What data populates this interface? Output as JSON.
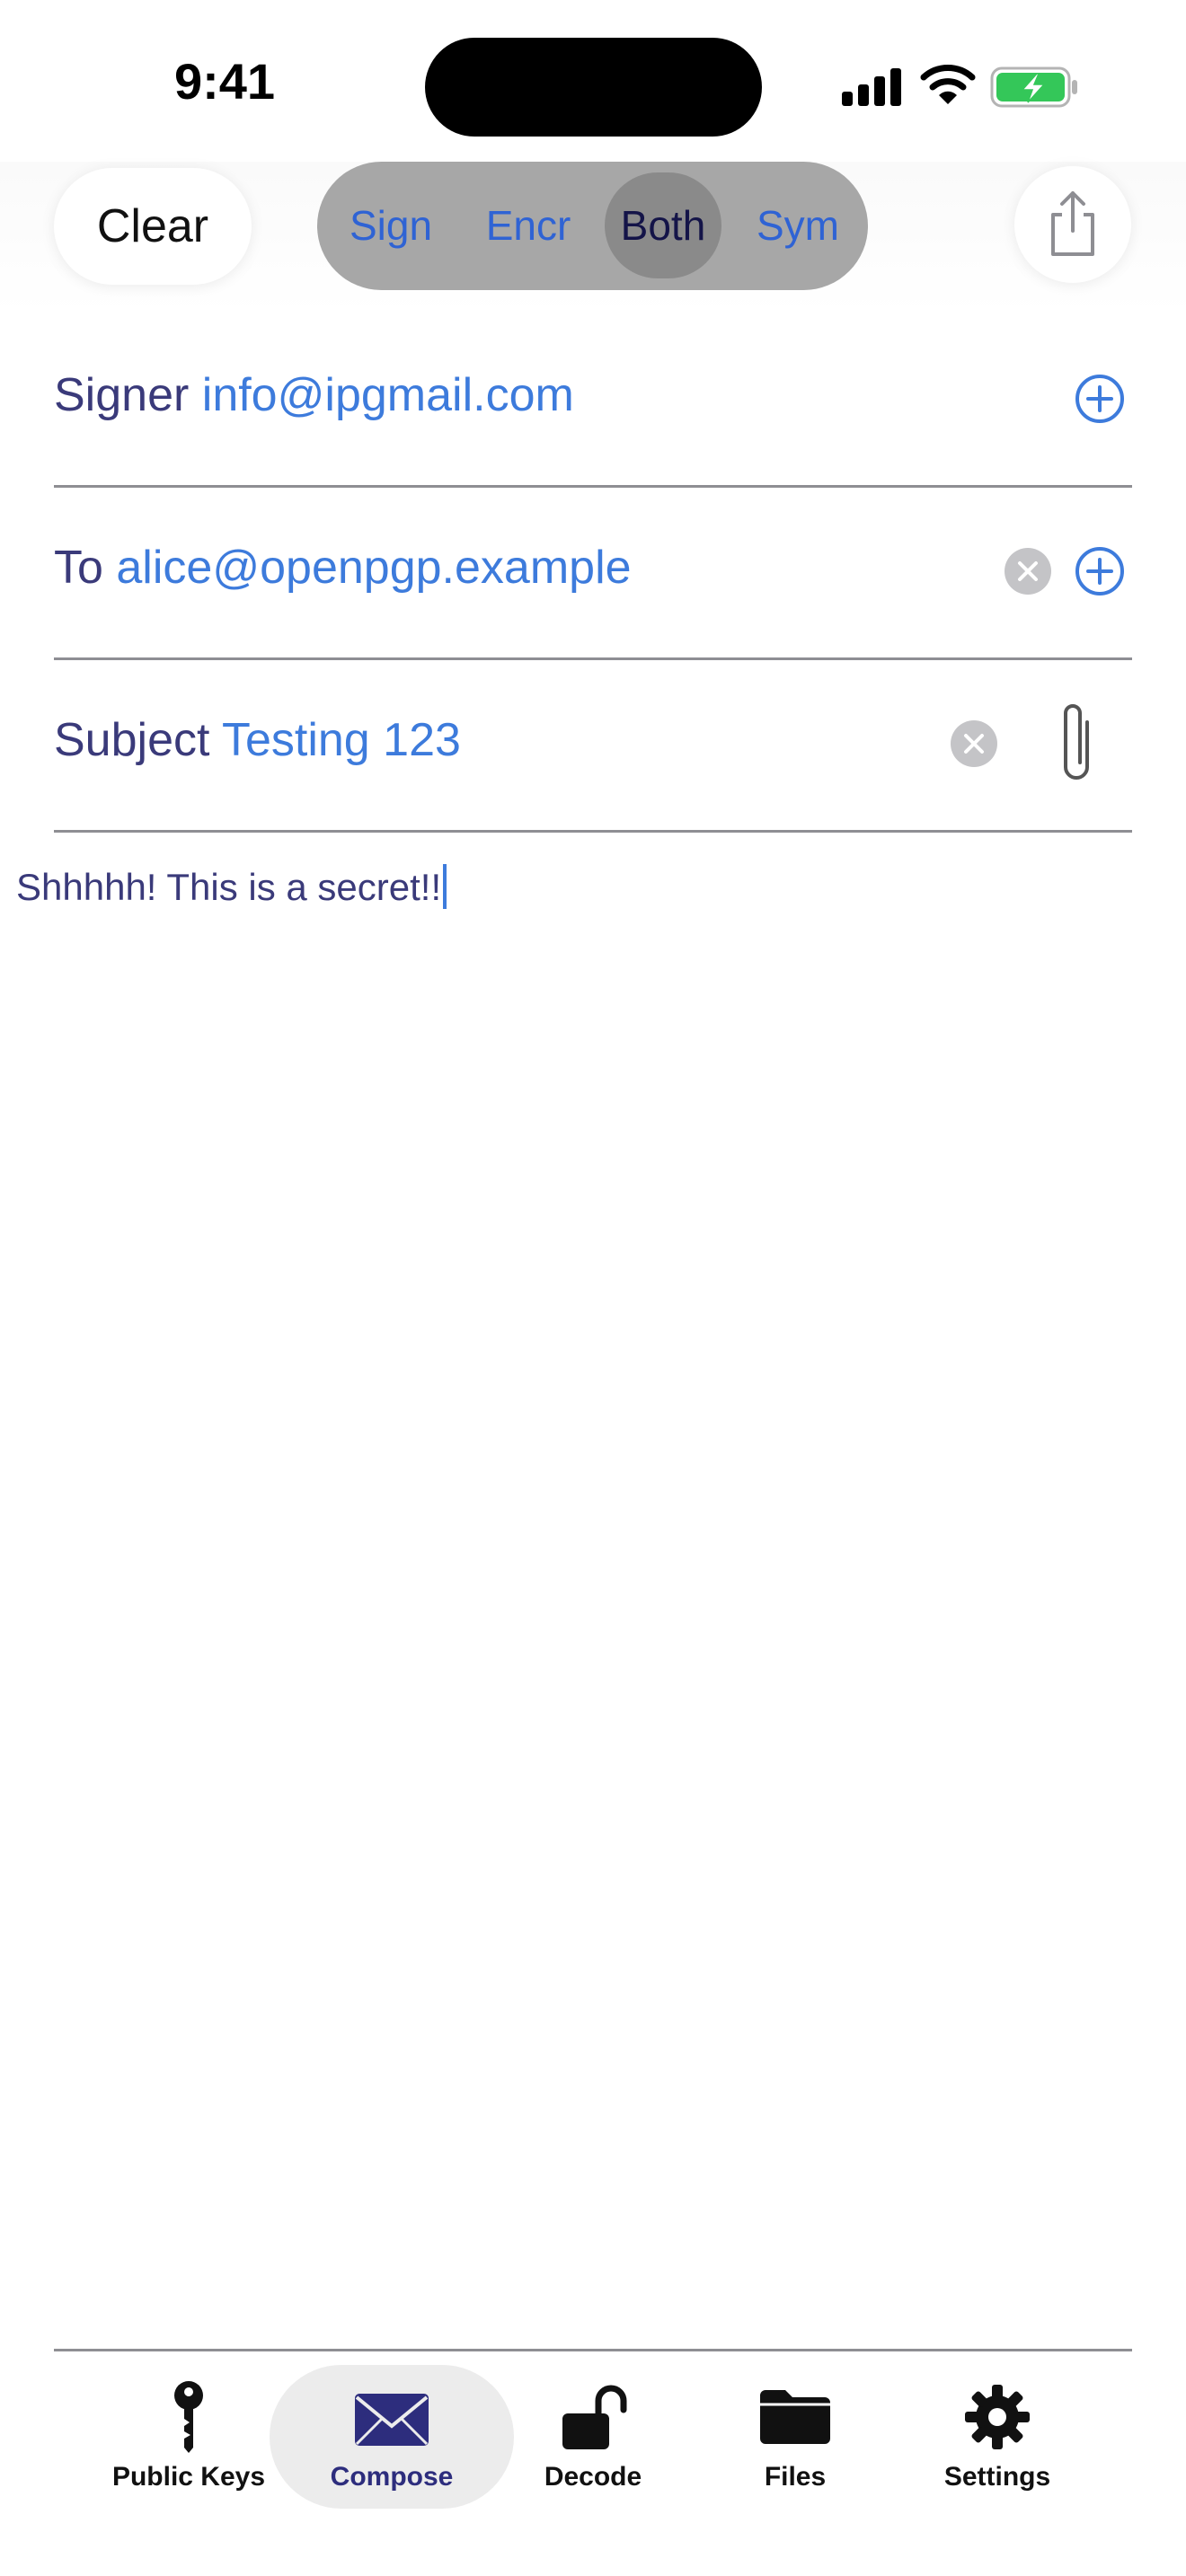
{
  "status_bar": {
    "time": "9:41"
  },
  "toolbar": {
    "clear_label": "Clear",
    "modes": [
      "Sign",
      "Encr",
      "Both",
      "Sym"
    ],
    "selected_mode": "Both"
  },
  "form": {
    "signer": {
      "label": "Signer",
      "value": "info@ipgmail.com"
    },
    "to": {
      "label": "To",
      "value": "alice@openpgp.example"
    },
    "subject": {
      "label": "Subject",
      "value": "Testing 123"
    }
  },
  "message": {
    "text": "Shhhhh! This is a secret!!"
  },
  "tabbar": {
    "items": [
      {
        "label": "Public Keys",
        "icon": "key-icon"
      },
      {
        "label": "Compose",
        "icon": "envelope-icon",
        "selected": true
      },
      {
        "label": "Decode",
        "icon": "unlock-icon"
      },
      {
        "label": "Files",
        "icon": "folder-icon"
      },
      {
        "label": "Settings",
        "icon": "gear-icon"
      }
    ]
  },
  "colors": {
    "accent": "#3d7bdc",
    "label": "#3a3a7a",
    "segment_bg": "#a7a7a7",
    "segment_selected": "#8a8a8a",
    "battery_fill": "#34c759"
  }
}
